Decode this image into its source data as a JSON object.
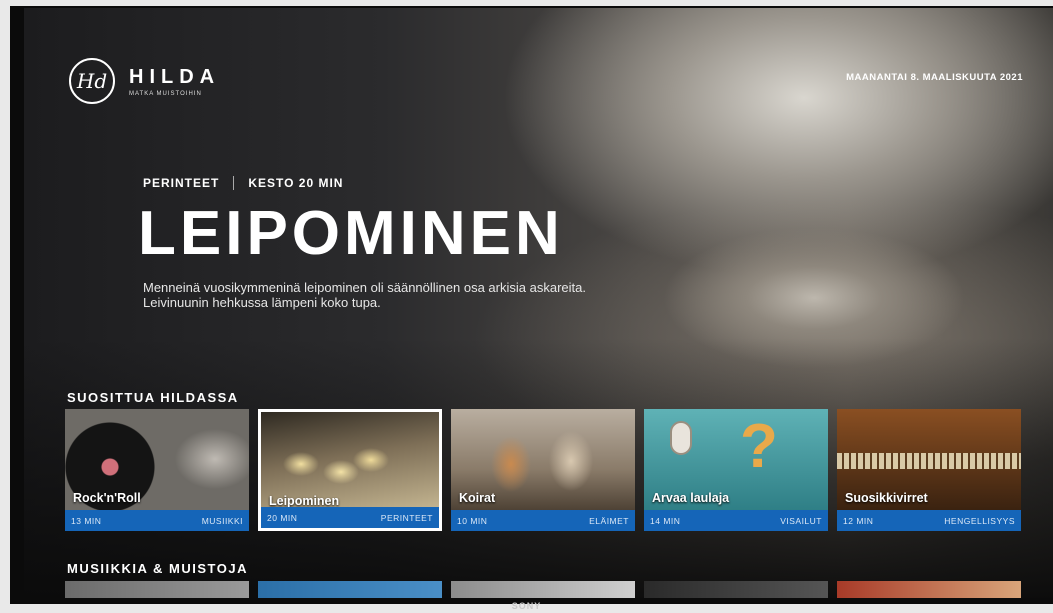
{
  "app": {
    "logo_mark": "Hd",
    "name": "HILDA",
    "tagline": "MATKA MUISTOIHIN"
  },
  "date": "MAANANTAI 8. MAALISKUUTA 2021",
  "hero": {
    "category": "PERINTEET",
    "duration": "KESTO 20 MIN",
    "title": "LEIPOMINEN",
    "description": "Menneinä vuosikymmeninä leipominen oli säännöllinen osa arkisia askareita. Leivinuunin hehkussa lämpeni koko tupa."
  },
  "rows": [
    {
      "title": "SUOSITTUA HILDASSA",
      "cards": [
        {
          "title": "Rock'n'Roll",
          "duration": "13 MIN",
          "category": "MUSIIKKI"
        },
        {
          "title": "Leipominen",
          "duration": "20 MIN",
          "category": "PERINTEET"
        },
        {
          "title": "Koirat",
          "duration": "10 MIN",
          "category": "ELÄIMET"
        },
        {
          "title": "Arvaa laulaja",
          "duration": "14 MIN",
          "category": "VISAILUT"
        },
        {
          "title": "Suosikkivirret",
          "duration": "12 MIN",
          "category": "HENGELLISYYS"
        }
      ]
    },
    {
      "title": "MUSIIKKIA & MUISTOJA"
    }
  ],
  "device_brand": "SONY",
  "colors": {
    "accent": "#1565b8",
    "background": "#1c1c1e"
  }
}
